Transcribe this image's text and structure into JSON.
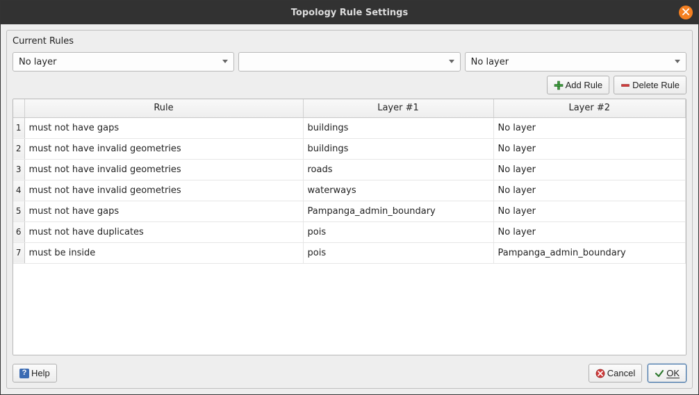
{
  "window": {
    "title": "Topology Rule Settings"
  },
  "labels": {
    "current_rules": "Current Rules",
    "add_rule": "Add Rule",
    "delete_rule": "Delete Rule",
    "help": "Help",
    "cancel": "Cancel",
    "ok": "OK"
  },
  "combos": {
    "layer1": "No layer",
    "rule": "",
    "layer2": "No layer"
  },
  "table": {
    "headers": {
      "rule": "Rule",
      "layer1": "Layer #1",
      "layer2": "Layer #2"
    },
    "rows": [
      {
        "n": "1",
        "rule": "must not have gaps",
        "layer1": "buildings",
        "layer2": "No layer"
      },
      {
        "n": "2",
        "rule": "must not have invalid geometries",
        "layer1": "buildings",
        "layer2": "No layer"
      },
      {
        "n": "3",
        "rule": "must not have invalid geometries",
        "layer1": "roads",
        "layer2": "No layer"
      },
      {
        "n": "4",
        "rule": "must not have invalid geometries",
        "layer1": "waterways",
        "layer2": "No layer"
      },
      {
        "n": "5",
        "rule": "must not have gaps",
        "layer1": "Pampanga_admin_boundary",
        "layer2": "No layer"
      },
      {
        "n": "6",
        "rule": "must not have duplicates",
        "layer1": "pois",
        "layer2": "No layer"
      },
      {
        "n": "7",
        "rule": "must be inside",
        "layer1": "pois",
        "layer2": "Pampanga_admin_boundary"
      }
    ]
  }
}
